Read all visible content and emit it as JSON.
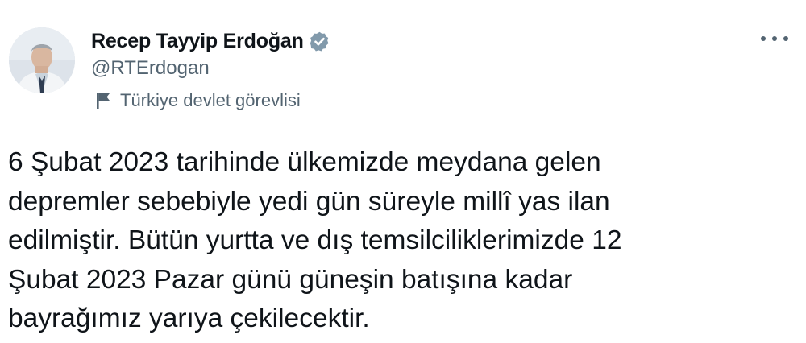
{
  "author": {
    "name": "Recep Tayyip Erdoğan",
    "handle": "@RTErdogan",
    "verified_badge_color": "#829aab",
    "avatar_icon": "profile-photo"
  },
  "label": {
    "icon": "flag-icon",
    "text": "Türkiye devlet görevlisi"
  },
  "menu": {
    "icon": "more-options-icon"
  },
  "tweet": {
    "text": "6 Şubat 2023 tarihinde ülkemizde meydana gelen\ndepremler sebebiyle yedi gün süreyle millî yas ilan\nedilmiştir. Bütün yurtta ve dış temsilciliklerimizde 12\nŞubat 2023 Pazar günü güneşin batışına kadar\nbayrağımız yarıya çekilecektir."
  },
  "colors": {
    "text_primary": "#0f1419",
    "text_secondary": "#536471",
    "background": "#ffffff"
  }
}
